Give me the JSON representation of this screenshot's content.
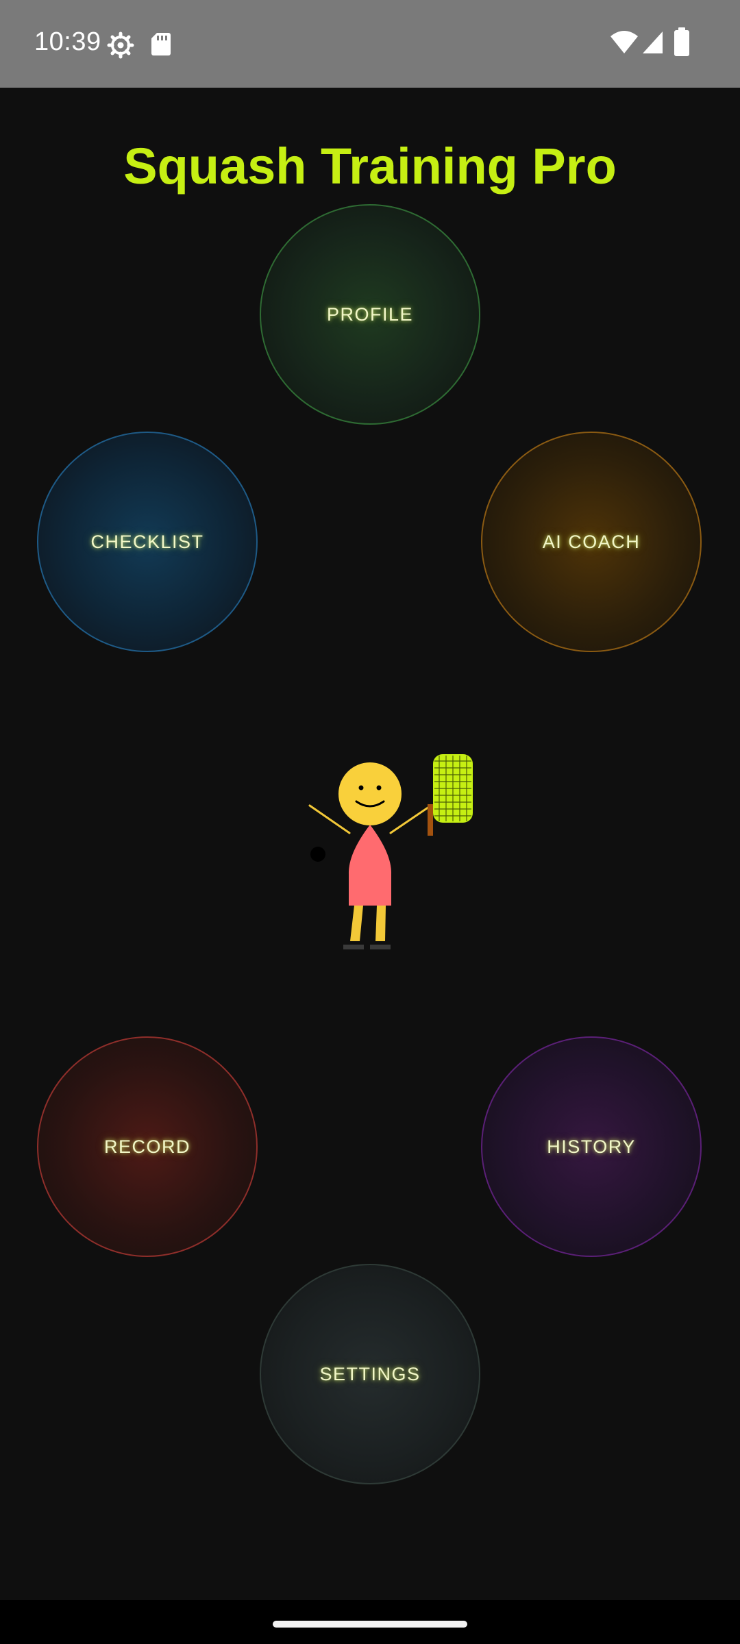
{
  "status_bar": {
    "time": "10:39",
    "icons": [
      "settings-gear-icon",
      "sd-card-icon",
      "wifi-icon",
      "signal-icon",
      "battery-icon"
    ]
  },
  "app": {
    "title": "Squash Training Pro",
    "accent_color": "#c6ef13"
  },
  "menu": {
    "profile": "PROFILE",
    "checklist": "CHECKLIST",
    "ai_coach": "AI COACH",
    "record": "RECORD",
    "history": "HISTORY",
    "settings": "SETTINGS"
  },
  "mascot": {
    "icon": "squash-player-mascot-icon"
  }
}
